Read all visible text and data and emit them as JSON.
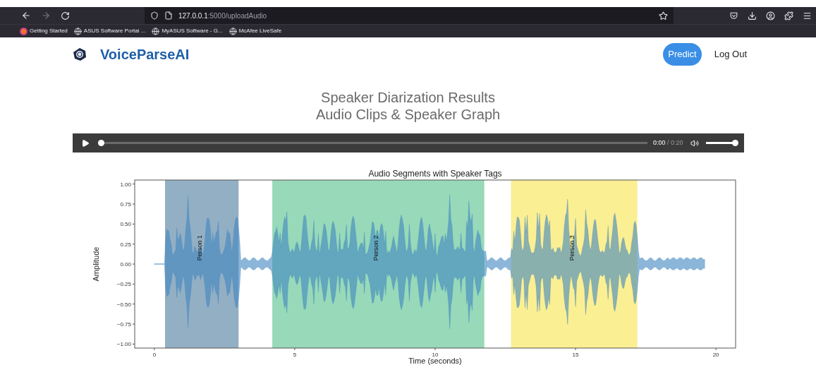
{
  "browser": {
    "url_host": "127.0.0.1",
    "url_path": ":5000/uploadAudio",
    "bookmarks": [
      {
        "kind": "firefox",
        "label": "Getting Started"
      },
      {
        "kind": "globe",
        "label": "ASUS Software Portal ..."
      },
      {
        "kind": "globe",
        "label": "MyASUS Software - G..."
      },
      {
        "kind": "globe",
        "label": "McAfee LiveSafe"
      }
    ]
  },
  "navbar": {
    "brand": "VoiceParseAI",
    "buttons": [
      {
        "label": "Predict",
        "selected": true
      },
      {
        "label": "Log Out",
        "selected": false
      }
    ]
  },
  "heading": [
    "Speaker Diarization Results",
    "Audio Clips & Speaker Graph"
  ],
  "player": {
    "current": "0:00",
    "duration": "/ 0:20",
    "progress": {
      "level": 0
    },
    "volume": {
      "level": 1
    }
  },
  "chart": {
    "title": "Audio Segments with Speaker Tags",
    "xlabel": "Time (seconds)",
    "ylabel": "Amplitude",
    "xticks": [
      "0",
      "5",
      "10",
      "15",
      "20"
    ],
    "yticks": [
      "1.00",
      "0.75",
      "0.50",
      "0.25",
      "0.00",
      "−0.25",
      "−0.50",
      "−0.75",
      "−1.00"
    ],
    "speakers": [
      {
        "label": "Person 1",
        "color": "#93afc4"
      },
      {
        "label": "Person 2",
        "color": "#97d9b9"
      },
      {
        "label": "Person 3",
        "color": "#fbef93"
      }
    ]
  }
}
